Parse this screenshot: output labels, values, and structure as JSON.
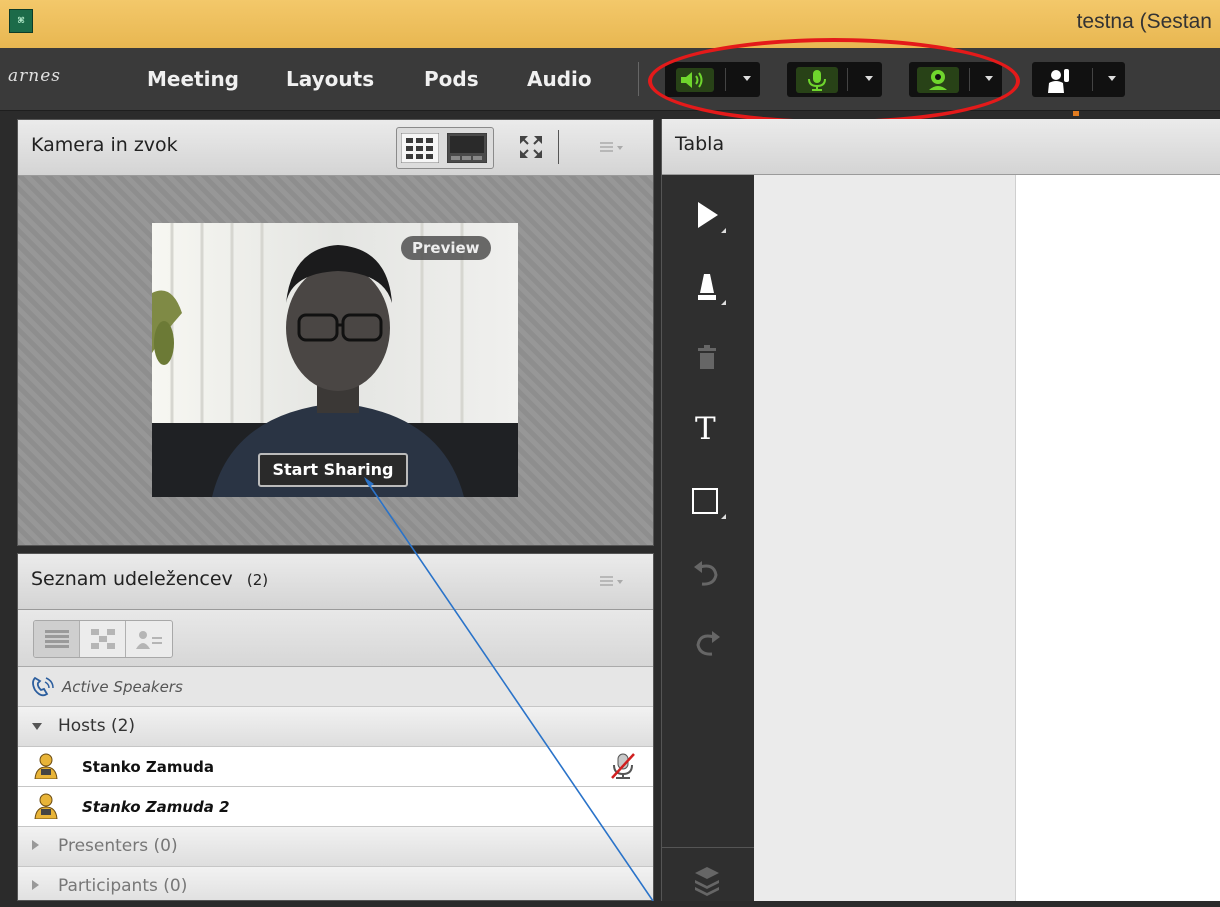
{
  "window": {
    "title": "testna (Sestan",
    "app_icon_glyph": "⌘"
  },
  "menubar": {
    "brand": "arnes",
    "items": [
      "Meeting",
      "Layouts",
      "Pods",
      "Audio"
    ],
    "controls": [
      {
        "name": "speaker-icon",
        "color": "#6fd62d"
      },
      {
        "name": "microphone-icon",
        "color": "#6fd62d"
      },
      {
        "name": "webcam-icon",
        "color": "#6fd62d"
      },
      {
        "name": "raise-hand-icon",
        "color": "#ffffff"
      }
    ],
    "highlight_color": "#e41a1a"
  },
  "camera_pod": {
    "title": "Kamera in zvok",
    "preview_label": "Preview",
    "start_sharing_label": "Start Sharing"
  },
  "attendee_pod": {
    "title": "Seznam udeležencev",
    "count": "(2)",
    "active_speakers_label": "Active Speakers",
    "hosts_label": "Hosts (2)",
    "hosts": [
      {
        "name": "Stanko Zamuda",
        "mic_muted": true
      },
      {
        "name": "Stanko Zamuda 2",
        "mic_muted": false
      }
    ],
    "presenters_label": "Presenters (0)",
    "participants_label": "Participants (0)"
  },
  "whiteboard_pod": {
    "title": "Tabla",
    "text_tool_glyph": "T",
    "tools": [
      "select-arrow-icon",
      "marker-icon",
      "trash-icon",
      "text-tool-icon",
      "rectangle-tool-icon",
      "undo-icon",
      "redo-icon",
      "layers-icon"
    ]
  },
  "annotation_color": "#2a73c9"
}
